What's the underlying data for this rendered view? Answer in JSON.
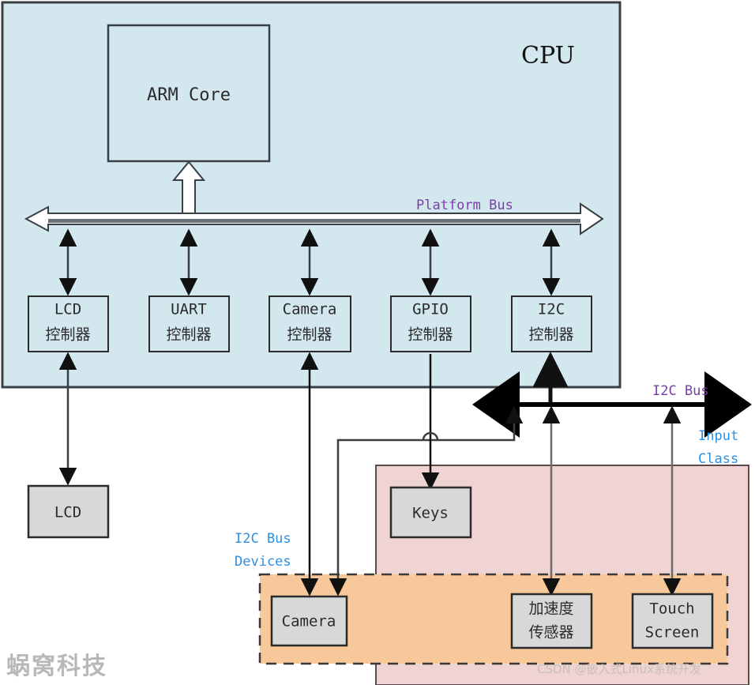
{
  "diagram": {
    "title": "CPU",
    "regions": {
      "cpu": {
        "label": "CPU",
        "fill": "#d3e7ef",
        "stroke": "#3a3f44"
      },
      "input_class": {
        "label_line1": "Input",
        "label_line2": "Class",
        "fill": "#f0d3d3",
        "stroke": "#5a4a4a"
      },
      "i2c_devices": {
        "label_line1": "I2C Bus",
        "label_line2": "Devices",
        "fill": "#f7c89a",
        "stroke": "#3a3a3a"
      }
    },
    "core": {
      "label": "ARM Core"
    },
    "buses": [
      {
        "name": "platform-bus",
        "label": "Platform Bus",
        "color": "#7b3fa8"
      },
      {
        "name": "i2c-bus",
        "label": "I2C Bus",
        "color": "#7b3fa8"
      }
    ],
    "annotations": [
      {
        "name": "input-class-annotation",
        "line1": "Input",
        "line2": "Class",
        "color": "#2f8fe0"
      },
      {
        "name": "i2c-bus-devices-annotation",
        "line1": "I2C Bus",
        "line2": "Devices",
        "color": "#2f8fe0"
      }
    ],
    "controllers": [
      {
        "name": "lcd-controller",
        "line1": "LCD",
        "line2": "控制器"
      },
      {
        "name": "uart-controller",
        "line1": "UART",
        "line2": "控制器"
      },
      {
        "name": "camera-controller",
        "line1": "Camera",
        "line2": "控制器"
      },
      {
        "name": "gpio-controller",
        "line1": "GPIO",
        "line2": "控制器"
      },
      {
        "name": "i2c-controller",
        "line1": "I2C",
        "line2": "控制器"
      }
    ],
    "devices": [
      {
        "name": "lcd-device",
        "line1": "LCD",
        "line2": ""
      },
      {
        "name": "keys-device",
        "line1": "Keys",
        "line2": ""
      },
      {
        "name": "camera-device",
        "line1": "Camera",
        "line2": ""
      },
      {
        "name": "accelerometer-device",
        "line1": "加速度",
        "line2": "传感器"
      },
      {
        "name": "touchscreen-device",
        "line1": "Touch",
        "line2": "Screen"
      }
    ],
    "watermarks": {
      "left": "蜗窝科技",
      "right": "CSDN @嵌入式Linux系统开发"
    },
    "colors": {
      "box_fill": "#d8d8d8",
      "box_stroke": "#2b2b2b",
      "line": "#111111",
      "accent_purple": "#7b3fa8",
      "accent_blue": "#2f8fe0"
    }
  }
}
